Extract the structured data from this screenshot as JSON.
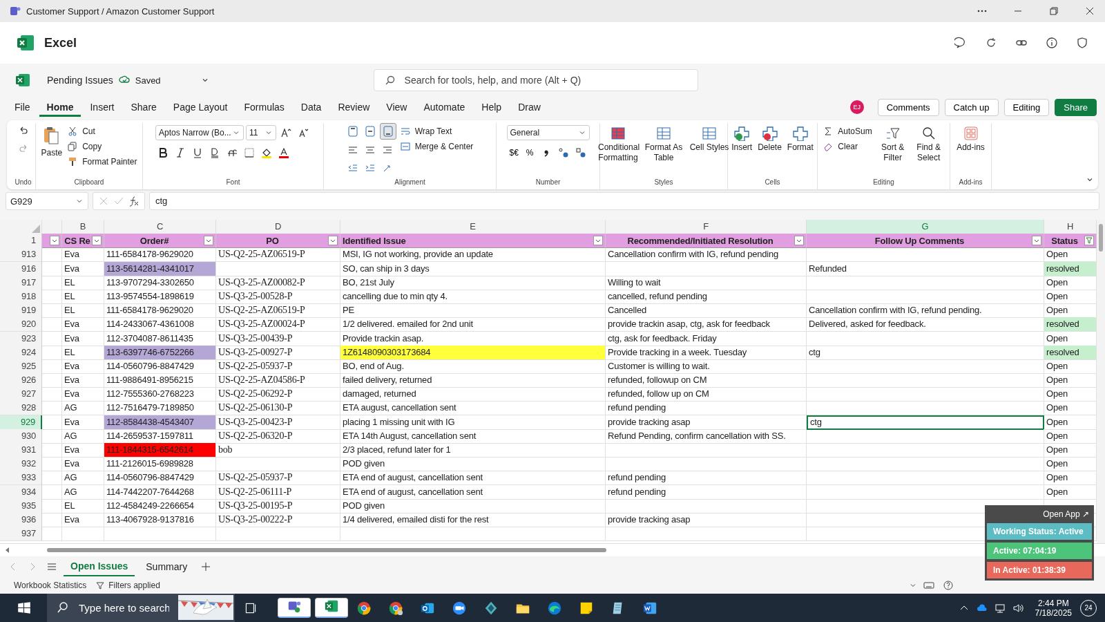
{
  "title_bar": {
    "title": "Customer Support / Amazon Customer Support"
  },
  "app_header": {
    "name": "Excel"
  },
  "document": {
    "name": "Pending Issues",
    "status": "Saved"
  },
  "search": {
    "placeholder": "Search for tools, help, and more (Alt + Q)"
  },
  "menu_tabs": [
    {
      "label": "File",
      "selected": false
    },
    {
      "label": "Home",
      "selected": true
    },
    {
      "label": "Insert",
      "selected": false
    },
    {
      "label": "Share",
      "selected": false
    },
    {
      "label": "Page Layout",
      "selected": false
    },
    {
      "label": "Formulas",
      "selected": false
    },
    {
      "label": "Data",
      "selected": false
    },
    {
      "label": "Review",
      "selected": false
    },
    {
      "label": "View",
      "selected": false
    },
    {
      "label": "Automate",
      "selected": false
    },
    {
      "label": "Help",
      "selected": false
    },
    {
      "label": "Draw",
      "selected": false
    }
  ],
  "user": {
    "initials": "EJ"
  },
  "actions": [
    "Comments",
    "Catch up",
    "Editing",
    "Share"
  ],
  "ribbon": {
    "undo": {
      "label": "Undo"
    },
    "clipboard": {
      "paste": "Paste",
      "cut": "Cut",
      "copy": "Copy",
      "format_painter": "Format Painter",
      "label": "Clipboard"
    },
    "font": {
      "family": "Aptos Narrow (Bo...",
      "size": "11",
      "label": "Font"
    },
    "alignment": {
      "vertical": [
        {
          "selected": false
        },
        {
          "selected": false
        },
        {
          "selected": true
        }
      ],
      "wrap_text": "Wrap Text",
      "merge_center": "Merge & Center",
      "label": "Alignment"
    },
    "number": {
      "format": "General",
      "currency": "$€",
      "percent": "%",
      "label": "Number"
    },
    "styles": {
      "items": [
        "Conditional Formatting",
        "Format As Table",
        "Cell Styles"
      ],
      "label": "Styles"
    },
    "cells": {
      "items": [
        "Insert",
        "Delete",
        "Format"
      ],
      "label": "Cells"
    },
    "editing": {
      "autosum": "AutoSum",
      "clear": "Clear",
      "items": [
        "Sort & Filter",
        "Find & Select"
      ],
      "label": "Editing"
    },
    "addins": {
      "button": "Add-ins",
      "label": "Add-ins"
    }
  },
  "formula_bar": {
    "name_box": "G929",
    "value": "ctg"
  },
  "sheet": {
    "columns": [
      {
        "selected": false
      },
      {
        "letter": "B",
        "selected": false
      },
      {
        "letter": "C",
        "selected": false
      },
      {
        "letter": "D",
        "selected": false
      },
      {
        "letter": "E",
        "selected": false
      },
      {
        "letter": "F",
        "selected": false
      },
      {
        "letter": "G",
        "selected": true
      },
      {
        "letter": "H",
        "selected": false
      }
    ],
    "header_row": {
      "num": "1",
      "cells": [
        null,
        "CS Re",
        "Order#",
        "PO",
        "Identified Issue",
        "Recommended/Initiated Resolution",
        "Follow Up Comments",
        "Status"
      ]
    },
    "rows": [
      {
        "num": "913",
        "selected": false,
        "cells": [
          {
            "text": "Eva"
          },
          {
            "text": "111-6584178-9629020"
          },
          {
            "text": "US-Q2-25-AZ06519-P"
          },
          {
            "text": "MSI, IG not working, provide an update"
          },
          {
            "text": "Cancellation confirm with IG, refund pending"
          },
          null,
          {
            "text": "Open"
          }
        ]
      },
      {
        "num": "916",
        "selected": false,
        "cells": [
          {
            "text": "Eva"
          },
          {
            "text": "113-5614281-4341017",
            "color": "#b4a7d6"
          },
          null,
          {
            "text": "SO, can ship in 3 days"
          },
          null,
          {
            "text": "Refunded"
          },
          {
            "text": "resolved",
            "color": "#c6efce"
          }
        ]
      },
      {
        "num": "917",
        "selected": false,
        "cells": [
          {
            "text": "EL"
          },
          {
            "text": "113-9707294-3302650"
          },
          {
            "text": "US-Q3-25-AZ00082-P"
          },
          {
            "text": "BO, 21st July"
          },
          {
            "text": "Willing to wait"
          },
          null,
          {
            "text": "Open"
          }
        ]
      },
      {
        "num": "918",
        "selected": false,
        "cells": [
          {
            "text": "EL"
          },
          {
            "text": "113-9574554-1898619"
          },
          {
            "text": "US-Q3-25-00528-P"
          },
          {
            "text": "cancelling due to min qty 4."
          },
          {
            "text": "cancelled, refund pending"
          },
          null,
          {
            "text": "Open"
          }
        ]
      },
      {
        "num": "919",
        "selected": false,
        "cells": [
          {
            "text": "EL"
          },
          {
            "text": "111-6584178-9629020"
          },
          {
            "text": "US-Q2-25-AZ06519-P"
          },
          {
            "text": "PE"
          },
          {
            "text": "Cancelled"
          },
          {
            "text": "Cancellation confirm with IG, refund pending."
          },
          {
            "text": "Open"
          }
        ]
      },
      {
        "num": "920",
        "selected": false,
        "cells": [
          {
            "text": "Eva"
          },
          {
            "text": "114-2433067-4361008"
          },
          {
            "text": "US-Q3-25-AZ00024-P"
          },
          {
            "text": "1/2 delivered. emailed for 2nd unit"
          },
          {
            "text": "provide trackin asap, ctg, ask for feedback"
          },
          {
            "text": "Delivered, asked for feedback."
          },
          {
            "text": "resolved",
            "color": "#c6efce"
          }
        ]
      },
      {
        "num": "923",
        "selected": false,
        "cells": [
          {
            "text": "Eva"
          },
          {
            "text": "112-3704087-8611435"
          },
          {
            "text": "US-Q3-25-00439-P"
          },
          {
            "text": "Provide trackin asap."
          },
          {
            "text": "ctg, ask for feedback. Friday"
          },
          null,
          {
            "text": "Open"
          }
        ]
      },
      {
        "num": "924",
        "selected": false,
        "cells": [
          {
            "text": "EL"
          },
          {
            "text": "113-6397746-6752266",
            "color": "#b4a7d6"
          },
          {
            "text": "US-Q3-25-00927-P"
          },
          {
            "text": "1Z6148090303173684",
            "color": "#ffff3c"
          },
          {
            "text": "Provide tracking in a week. Tuesday"
          },
          {
            "text": "ctg"
          },
          {
            "text": "resolved",
            "color": "#c6efce"
          }
        ]
      },
      {
        "num": "925",
        "selected": false,
        "cells": [
          {
            "text": "Eva"
          },
          {
            "text": "114-0560796-8847429"
          },
          {
            "text": "US-Q2-25-05937-P"
          },
          {
            "text": "BO, end of Aug."
          },
          {
            "text": "Customer is willing to wait."
          },
          null,
          {
            "text": "Open"
          }
        ]
      },
      {
        "num": "926",
        "selected": false,
        "cells": [
          {
            "text": "Eva"
          },
          {
            "text": "111-9886491-8956215"
          },
          {
            "text": "US-Q2-25-AZ04586-P"
          },
          {
            "text": "failed delivery, returned"
          },
          {
            "text": "refunded, followup on CM"
          },
          null,
          {
            "text": "Open"
          }
        ]
      },
      {
        "num": "927",
        "selected": false,
        "cells": [
          {
            "text": "Eva"
          },
          {
            "text": "112-7555360-2768223"
          },
          {
            "text": "US-Q2-25-06292-P"
          },
          {
            "text": "damaged, returned"
          },
          {
            "text": "refunded, follow up on CM"
          },
          null,
          {
            "text": "Open"
          }
        ]
      },
      {
        "num": "928",
        "selected": false,
        "cells": [
          {
            "text": "AG"
          },
          {
            "text": "112-7516479-7189850"
          },
          {
            "text": "US-Q2-25-06130-P"
          },
          {
            "text": "ETA august, cancellation sent"
          },
          {
            "text": "refund pending"
          },
          null,
          {
            "text": "Open"
          }
        ]
      },
      {
        "num": "929",
        "selected": true,
        "cells": [
          {
            "text": "Eva"
          },
          {
            "text": "112-8584438-4543407",
            "color": "#b4a7d6"
          },
          {
            "text": "US-Q3-25-00423-P"
          },
          {
            "text": "placing 1 missing unit with IG"
          },
          {
            "text": "provide tracking asap"
          },
          {
            "text": "ctg"
          },
          {
            "text": "Open"
          }
        ]
      },
      {
        "num": "930",
        "selected": false,
        "cells": [
          {
            "text": "AG"
          },
          {
            "text": "114-2659537-1597811"
          },
          {
            "text": "US-Q2-25-06320-P"
          },
          {
            "text": "ETA 14th August, cancellation sent"
          },
          {
            "text": "Refund Pending, confirm cancellation with SS."
          },
          null,
          {
            "text": "Open"
          }
        ]
      },
      {
        "num": "931",
        "selected": false,
        "cells": [
          {
            "text": "Eva"
          },
          {
            "text": "111-1844315-6542614",
            "color": "#ff0000"
          },
          {
            "text": "bob"
          },
          {
            "text": "2/3 placed, refund later for 1"
          },
          null,
          null,
          {
            "text": "Open"
          }
        ]
      },
      {
        "num": "932",
        "selected": false,
        "cells": [
          {
            "text": "Eva"
          },
          {
            "text": "111-2126015-6989828"
          },
          null,
          {
            "text": "POD given"
          },
          null,
          null,
          {
            "text": "Open"
          }
        ]
      },
      {
        "num": "933",
        "selected": false,
        "cells": [
          {
            "text": "AG"
          },
          {
            "text": "114-0560796-8847429"
          },
          {
            "text": "US-Q2-25-05937-P"
          },
          {
            "text": "ETA end of august, cancellation sent"
          },
          {
            "text": "refund pending"
          },
          null,
          {
            "text": "Open"
          }
        ]
      },
      {
        "num": "934",
        "selected": false,
        "cells": [
          {
            "text": "AG"
          },
          {
            "text": "114-7442207-7644268"
          },
          {
            "text": "US-Q2-25-06111-P"
          },
          {
            "text": "ETA end of august, cancellation sent"
          },
          {
            "text": "refund pending"
          },
          null,
          {
            "text": "Open"
          }
        ]
      },
      {
        "num": "935",
        "selected": false,
        "cells": [
          {
            "text": "EL"
          },
          {
            "text": "112-4584249-2266654"
          },
          {
            "text": "US-Q3-25-00195-P"
          },
          {
            "text": "POD given"
          },
          null,
          null,
          null
        ]
      },
      {
        "num": "936",
        "selected": false,
        "cells": [
          {
            "text": "Eva"
          },
          {
            "text": "113-4067928-9137816"
          },
          {
            "text": "US-Q3-25-00222-P"
          },
          {
            "text": "1/4 delivered, emailed disti for the rest"
          },
          {
            "text": "provide tracking asap"
          },
          null,
          null
        ]
      },
      {
        "num": "937",
        "selected": false
      }
    ]
  },
  "sheet_tabs": [
    {
      "label": "Open Issues",
      "selected": true
    },
    {
      "label": "Summary",
      "selected": false
    }
  ],
  "status_bar": [
    "Workbook Statistics",
    "Filters applied"
  ],
  "tracker": {
    "open_app": "Open App ↗",
    "status": "Working Status: Active",
    "active": "Active: 07:04:19",
    "inactive": "In Active: 01:38:39"
  },
  "taskbar": {
    "search_placeholder": "Type here to search",
    "time": "2:44 PM",
    "date": "7/18/2025",
    "notifications": "24"
  }
}
